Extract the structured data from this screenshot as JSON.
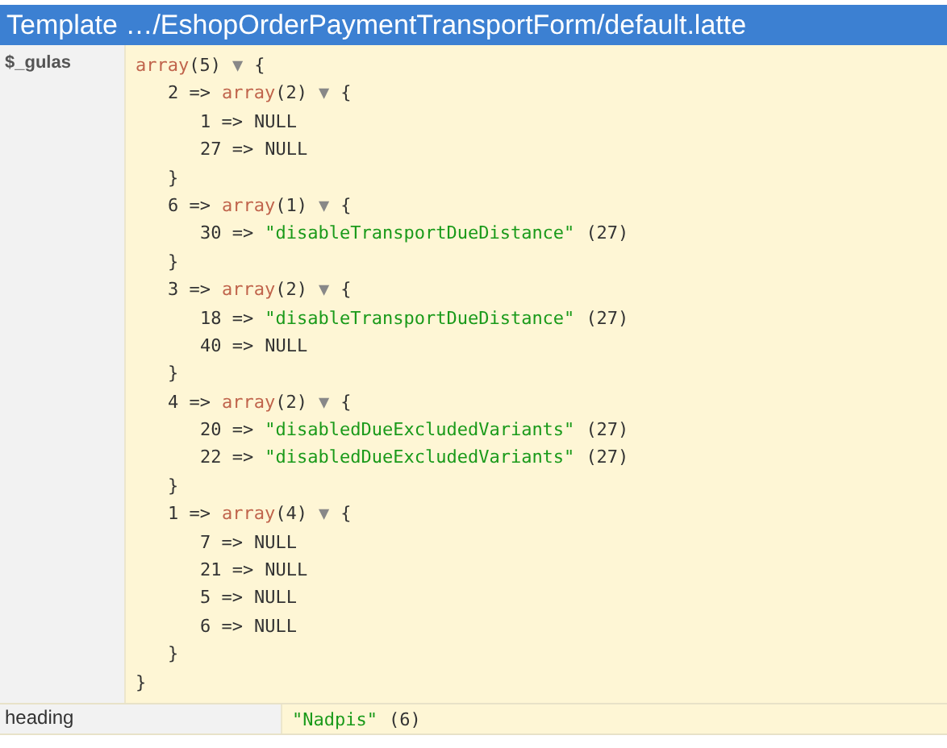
{
  "window": {
    "title": "Template …/EshopOrderPaymentTransportForm/default.latte"
  },
  "variables": [
    {
      "name": "$_gulas",
      "dump": {
        "kind": "array",
        "type": "array",
        "count": "(5)",
        "toggle": "▼",
        "open": "{",
        "close": "}",
        "expanded": true,
        "children": [
          {
            "key": "2 =>",
            "kind": "array",
            "type": "array",
            "count": "(2)",
            "toggle": "▼",
            "open": "{",
            "close": "}",
            "expanded": true,
            "children": [
              {
                "key": "1 =>",
                "kind": "null",
                "value": "NULL"
              },
              {
                "key": "27 =>",
                "kind": "null",
                "value": "NULL"
              }
            ]
          },
          {
            "key": "6 =>",
            "kind": "array",
            "type": "array",
            "count": "(1)",
            "toggle": "▼",
            "open": "{",
            "close": "}",
            "expanded": true,
            "children": [
              {
                "key": "30 =>",
                "kind": "string",
                "value": "\"disableTransportDueDistance\"",
                "length": "(27)"
              }
            ]
          },
          {
            "key": "3 =>",
            "kind": "array",
            "type": "array",
            "count": "(2)",
            "toggle": "▼",
            "open": "{",
            "close": "}",
            "expanded": true,
            "children": [
              {
                "key": "18 =>",
                "kind": "string",
                "value": "\"disableTransportDueDistance\"",
                "length": "(27)"
              },
              {
                "key": "40 =>",
                "kind": "null",
                "value": "NULL"
              }
            ]
          },
          {
            "key": "4 =>",
            "kind": "array",
            "type": "array",
            "count": "(2)",
            "toggle": "▼",
            "open": "{",
            "close": "}",
            "expanded": true,
            "children": [
              {
                "key": "20 =>",
                "kind": "string",
                "value": "\"disabledDueExcludedVariants\"",
                "length": "(27)"
              },
              {
                "key": "22 =>",
                "kind": "string",
                "value": "\"disabledDueExcludedVariants\"",
                "length": "(27)"
              }
            ]
          },
          {
            "key": "1 =>",
            "kind": "array",
            "type": "array",
            "count": "(4)",
            "toggle": "▼",
            "open": "{",
            "close": "}",
            "expanded": true,
            "children": [
              {
                "key": "7 =>",
                "kind": "null",
                "value": "NULL"
              },
              {
                "key": "21 =>",
                "kind": "null",
                "value": "NULL"
              },
              {
                "key": "5 =>",
                "kind": "null",
                "value": "NULL"
              },
              {
                "key": "6 =>",
                "kind": "null",
                "value": "NULL"
              }
            ]
          }
        ]
      }
    },
    {
      "name": "heading",
      "dump": {
        "kind": "string",
        "value": "\"Nadpis\"",
        "length": "(6)"
      }
    }
  ]
}
